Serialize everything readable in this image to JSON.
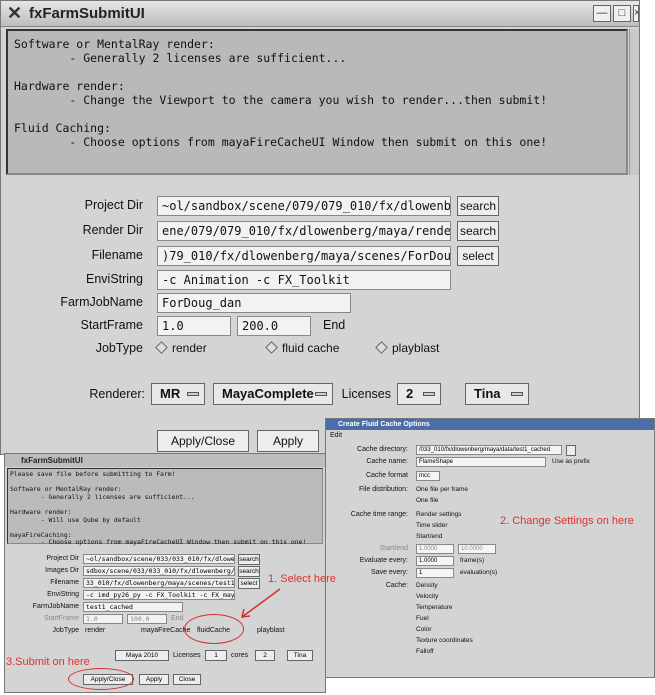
{
  "window": {
    "title": "fxFarmSubmitUI",
    "controls": [
      "—",
      "□",
      "×"
    ]
  },
  "message": "Software or MentalRay render:\n        - Generally 2 licenses are sufficient...\n\nHardware render:\n        - Change the Viewport to the camera you wish to render...then submit!\n\nFluid Caching:\n        - Choose options from mayaFireCacheUI Window then submit on this one!",
  "form": {
    "project_dir": {
      "label": "Project Dir",
      "value": "~ol/sandbox/scene/079/079_010/fx/dlowenberg/maya",
      "button": "search"
    },
    "render_dir": {
      "label": "Render Dir",
      "value": "ene/079/079_010/fx/dlowenberg/maya/renderOutput/",
      "button": "search"
    },
    "filename": {
      "label": "Filename",
      "value": ")79_010/fx/dlowenberg/maya/scenes/ForDoug_dan.ma",
      "button": "select"
    },
    "envistring": {
      "label": "EnviString",
      "value": "-c Animation -c FX_Toolkit"
    },
    "farmjobname": {
      "label": "FarmJobName",
      "value": "ForDoug_dan"
    },
    "startframe": {
      "label": "StartFrame",
      "start": "1.0",
      "end": "200.0",
      "end_label": "End"
    },
    "jobtype": {
      "label": "JobType",
      "options": [
        "render",
        "fluid cache",
        "playblast"
      ]
    }
  },
  "renderer": {
    "label": "Renderer:",
    "renderer_value": "MR",
    "package_value": "MayaComplete",
    "licenses_label": "Licenses",
    "licenses_value": "2",
    "user_value": "Tina"
  },
  "buttons": {
    "apply_close": "Apply/Close",
    "apply": "Apply"
  },
  "small_window": {
    "title": "fxFarmSubmitUI",
    "message": "Please save file before submitting to Farm!\n\nSoftware or MentalRay render:\n        - Generally 2 licenses are sufficient...\n\nHardware render:\n        - Will use Qube by default\n\nmayaFireCaching:\n        - Choose options from mayaFireCacheUI Window then submit on this one!",
    "project_dir": "~ol/sandbox/scene/033/033_010/fx/dlowenberg/maya",
    "images_dir": "sdbox/scene/033/033_010/fx/dlowenberg/maya/imFd/",
    "filename": "33_010/fx/dlowenberg/maya/scenes/test1_cached.mb",
    "envistring": "-c imd_py26_py -c FX_Toolkit -c FX_maya-2010",
    "farmjobname": "test1_cached",
    "start": "1.0",
    "end": "100.0",
    "labels": {
      "project": "Project Dir",
      "images": "Images Dir",
      "filename": "Filename",
      "envi": "EnviString",
      "job": "FarmJobName",
      "start": "StartFrame",
      "end": "End",
      "jobtype": "JobType"
    },
    "search": "search",
    "select": "select",
    "jobtypes": [
      "render",
      "mayaFireCache",
      "fluidCache",
      "playblast"
    ],
    "maya_version": "Maya 2010",
    "licenses_label": "Licenses",
    "licenses_value": "1",
    "cores_label": "cores",
    "cores_value": "2",
    "user": "Tina",
    "apply_close": "Apply/Close",
    "apply": "Apply",
    "close": "Close"
  },
  "cache_window": {
    "title": "Create Fluid Cache Options",
    "menu": "Edit",
    "directory_label": "Cache directory:",
    "directory_value": "/033_010/fx/dlowenberg/maya/data/test1_cached",
    "name_label": "Cache name:",
    "name_value": "FlameShape",
    "use_prefix": "Use as prefix",
    "format_label": "Cache format",
    "format_value": "mcc",
    "distribution_label": "File distribution:",
    "distribution_options": [
      "One file per frame",
      "One file"
    ],
    "time_range_label": "Cache time range:",
    "time_range_options": [
      "Render settings",
      "Time slider",
      "Start/end"
    ],
    "startend_label": "Start/end",
    "start_value": "1.0000",
    "end_value": "10.0000",
    "evaluate_label": "Evaluate every:",
    "evaluate_value": "1.0000",
    "evaluate_unit": "frame(s)",
    "save_label": "Save every:",
    "save_value": "1",
    "save_unit": "evaluation(s)",
    "cache_label": "Cache:",
    "cache_options": [
      "Density",
      "Velocity",
      "Temperature",
      "Fuel",
      "Color",
      "Texture coordinates",
      "Falloff"
    ]
  },
  "annotations": {
    "step1": "1. Select here",
    "step2": "2. Change Settings on here",
    "step3": "3.Submit on here"
  }
}
